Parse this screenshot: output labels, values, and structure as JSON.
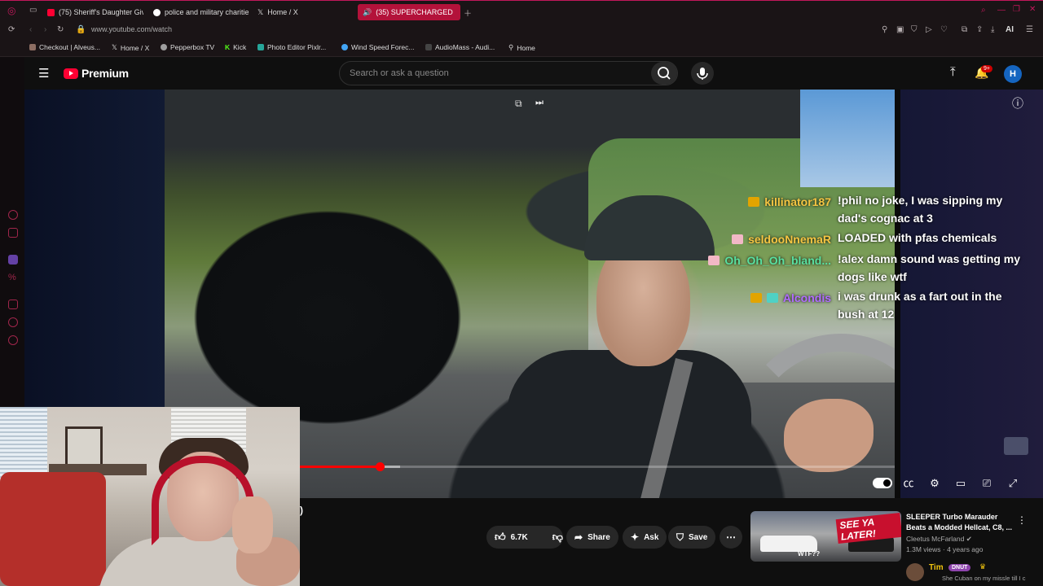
{
  "browser": {
    "tabs": [
      {
        "label": "(75) Sheriff's Daughter Giv",
        "color": "#ff0033"
      },
      {
        "label": "police and military charitie",
        "color": "#ffffff"
      },
      {
        "label": "Home / X",
        "color": "#ffffff"
      },
      {
        "label": "(35) SUPERCHARGED",
        "color": "#ffffff"
      }
    ],
    "url": "www.youtube.com/watch",
    "bookmarks": [
      {
        "label": "Checkout | Alveus...",
        "color": "#8d6e63"
      },
      {
        "label": "Home / X",
        "color": "#ffffff"
      },
      {
        "label": "Pepperbox TV",
        "color": "#9e9e9e"
      },
      {
        "label": "Kick",
        "color": "#53fc18"
      },
      {
        "label": "Photo Editor Pixlr...",
        "color": "#26a69a"
      },
      {
        "label": "Wind Speed Forec...",
        "color": "#42a5f5"
      },
      {
        "label": "AudioMass - Audi...",
        "color": "#444444"
      },
      {
        "label": "Home",
        "color": "#ffffff"
      }
    ],
    "toolbar_ai": "AI"
  },
  "youtube": {
    "logo_text": "Premium",
    "search_placeholder": "Search or ask a question",
    "notification_badge": "9+",
    "avatar_letter": "H"
  },
  "overlay_chat": [
    {
      "user": "killinator187",
      "color": "#f5c542",
      "text": "!phil no joke, I was sipping my dad's cognac at 3",
      "badges": [
        "#e2a400"
      ]
    },
    {
      "user": "seldooNnemaR",
      "color": "#f5c542",
      "text": "LOADED with pfas chemicals",
      "badges": [
        "#f2b8c6"
      ]
    },
    {
      "user": "Oh_Oh_Oh_bland...",
      "color": "#59e0a0",
      "text": "!alex damn sound was getting my dogs like wtf",
      "badges": [
        "#f2b8c6"
      ]
    },
    {
      "user": "Alcondis",
      "color": "#b06bff",
      "text": "i was drunk as a fart out in the bush at 12",
      "badges": [
        "#e2a400",
        "#4fd1c5"
      ]
    }
  ],
  "player": {
    "progress_played": 0.134,
    "progress_buffered": 0.168,
    "partial_title": ")"
  },
  "actions": {
    "likes": "6.7K",
    "share": "Share",
    "ask": "Ask",
    "save": "Save"
  },
  "recommendation": {
    "title": "SLEEPER Turbo Marauder Beats a Modded Hellcat, C8, ...",
    "channel": "Cleetus McFarland",
    "meta": "1.3M views · 4 years ago",
    "thumb_tag": "SEE YA LATER!",
    "thumb_small": "WTF??"
  },
  "live_chat": {
    "user": "Tim",
    "badge": "DNUT",
    "text": "She Cuban on my missle till I c"
  }
}
